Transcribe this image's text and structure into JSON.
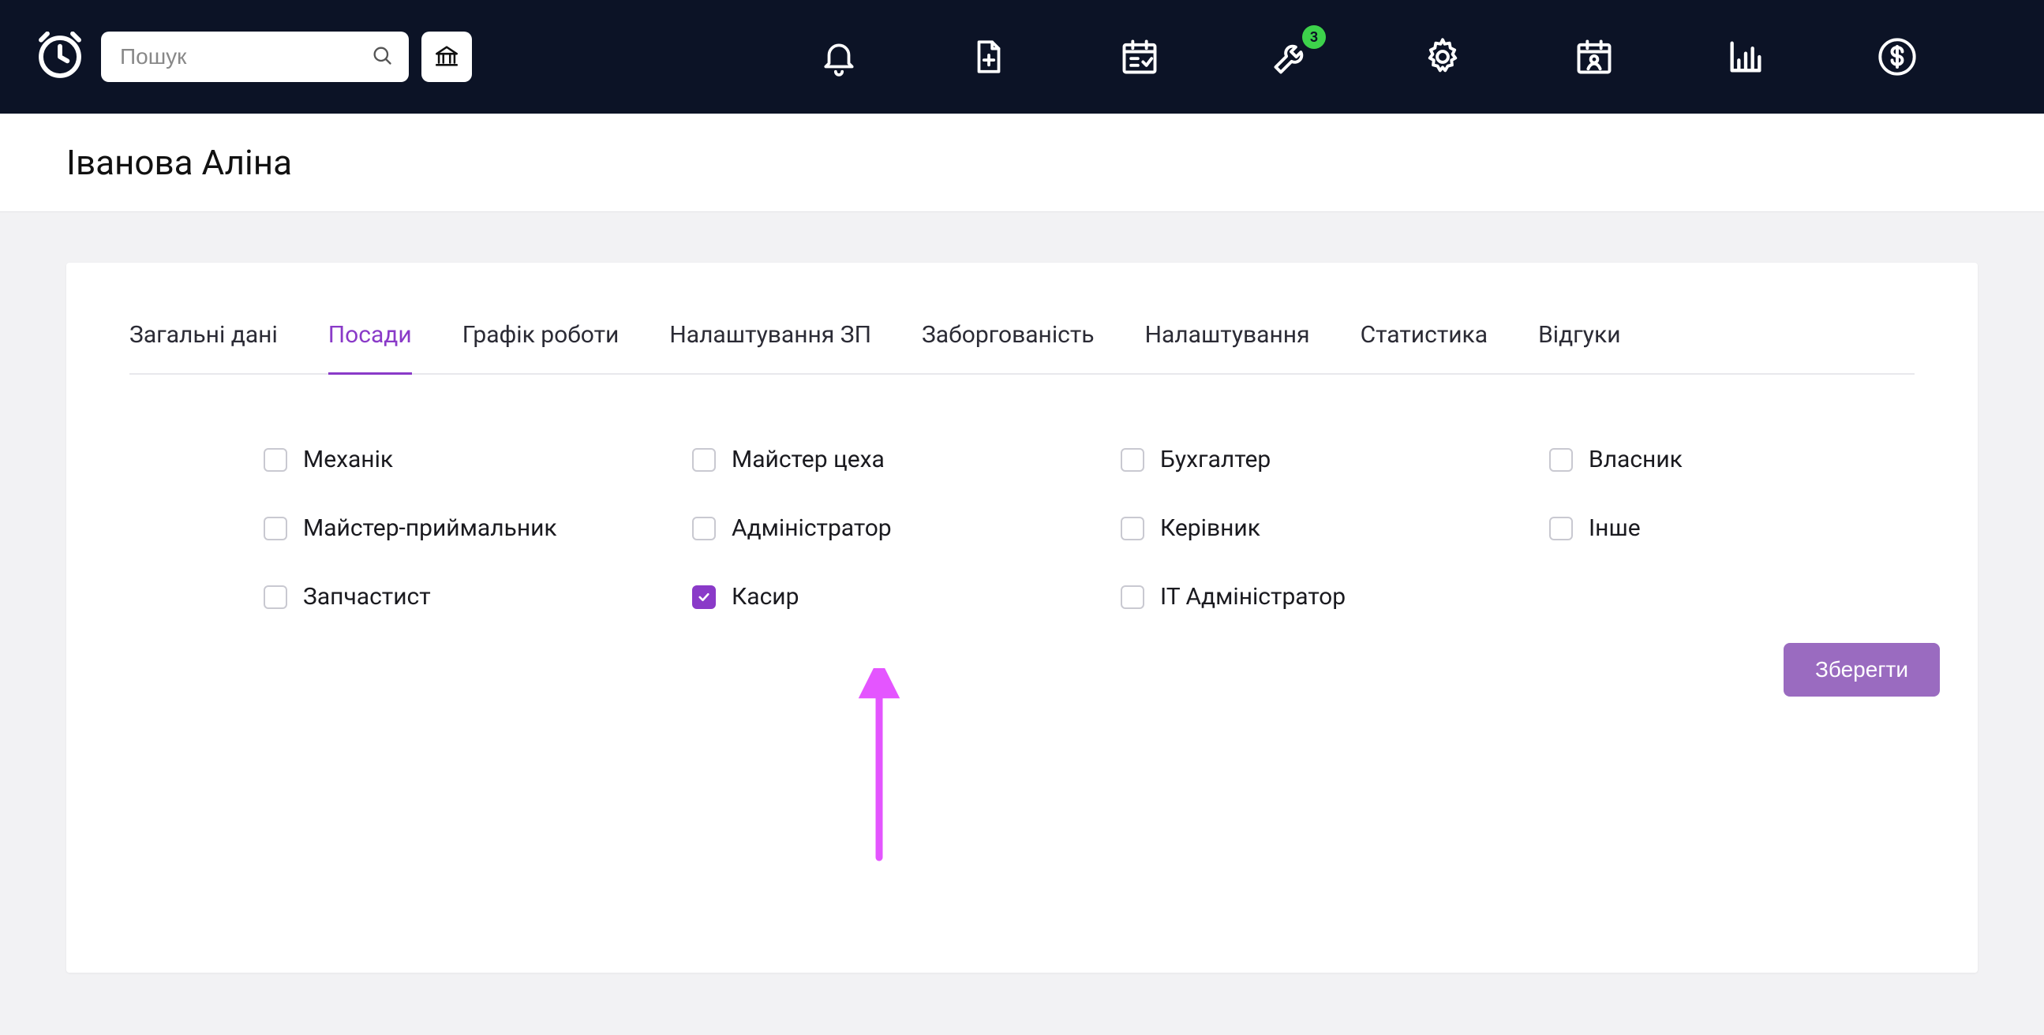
{
  "search": {
    "placeholder": "Пошук"
  },
  "topnav": {
    "badge_count": "3"
  },
  "header": {
    "title": "Іванова Аліна"
  },
  "tabs": [
    {
      "id": "general",
      "label": "Загальні дані",
      "active": false
    },
    {
      "id": "positions",
      "label": "Посади",
      "active": true
    },
    {
      "id": "schedule",
      "label": "Графік роботи",
      "active": false
    },
    {
      "id": "salary",
      "label": "Налаштування ЗП",
      "active": false
    },
    {
      "id": "debt",
      "label": "Заборгованість",
      "active": false
    },
    {
      "id": "settings",
      "label": "Налаштування",
      "active": false
    },
    {
      "id": "stats",
      "label": "Статистика",
      "active": false
    },
    {
      "id": "reviews",
      "label": "Відгуки",
      "active": false
    }
  ],
  "positions": [
    {
      "id": "mechanic",
      "label": "Механік",
      "checked": false
    },
    {
      "id": "shop-master",
      "label": "Майстер цеха",
      "checked": false
    },
    {
      "id": "accountant",
      "label": "Бухгалтер",
      "checked": false
    },
    {
      "id": "owner",
      "label": "Власник",
      "checked": false
    },
    {
      "id": "service-advisor",
      "label": "Майстер-приймальник",
      "checked": false
    },
    {
      "id": "admin",
      "label": "Адміністратор",
      "checked": false
    },
    {
      "id": "manager",
      "label": "Керівник",
      "checked": false
    },
    {
      "id": "other",
      "label": "Інше",
      "checked": false
    },
    {
      "id": "parts",
      "label": "Запчастист",
      "checked": false
    },
    {
      "id": "cashier",
      "label": "Касир",
      "checked": true
    },
    {
      "id": "it-admin",
      "label": "IT Адміністратор",
      "checked": false
    }
  ],
  "actions": {
    "save_label": "Зберегти"
  },
  "accent_color": "#8a3ac8",
  "annotation_color": "#e455ff"
}
